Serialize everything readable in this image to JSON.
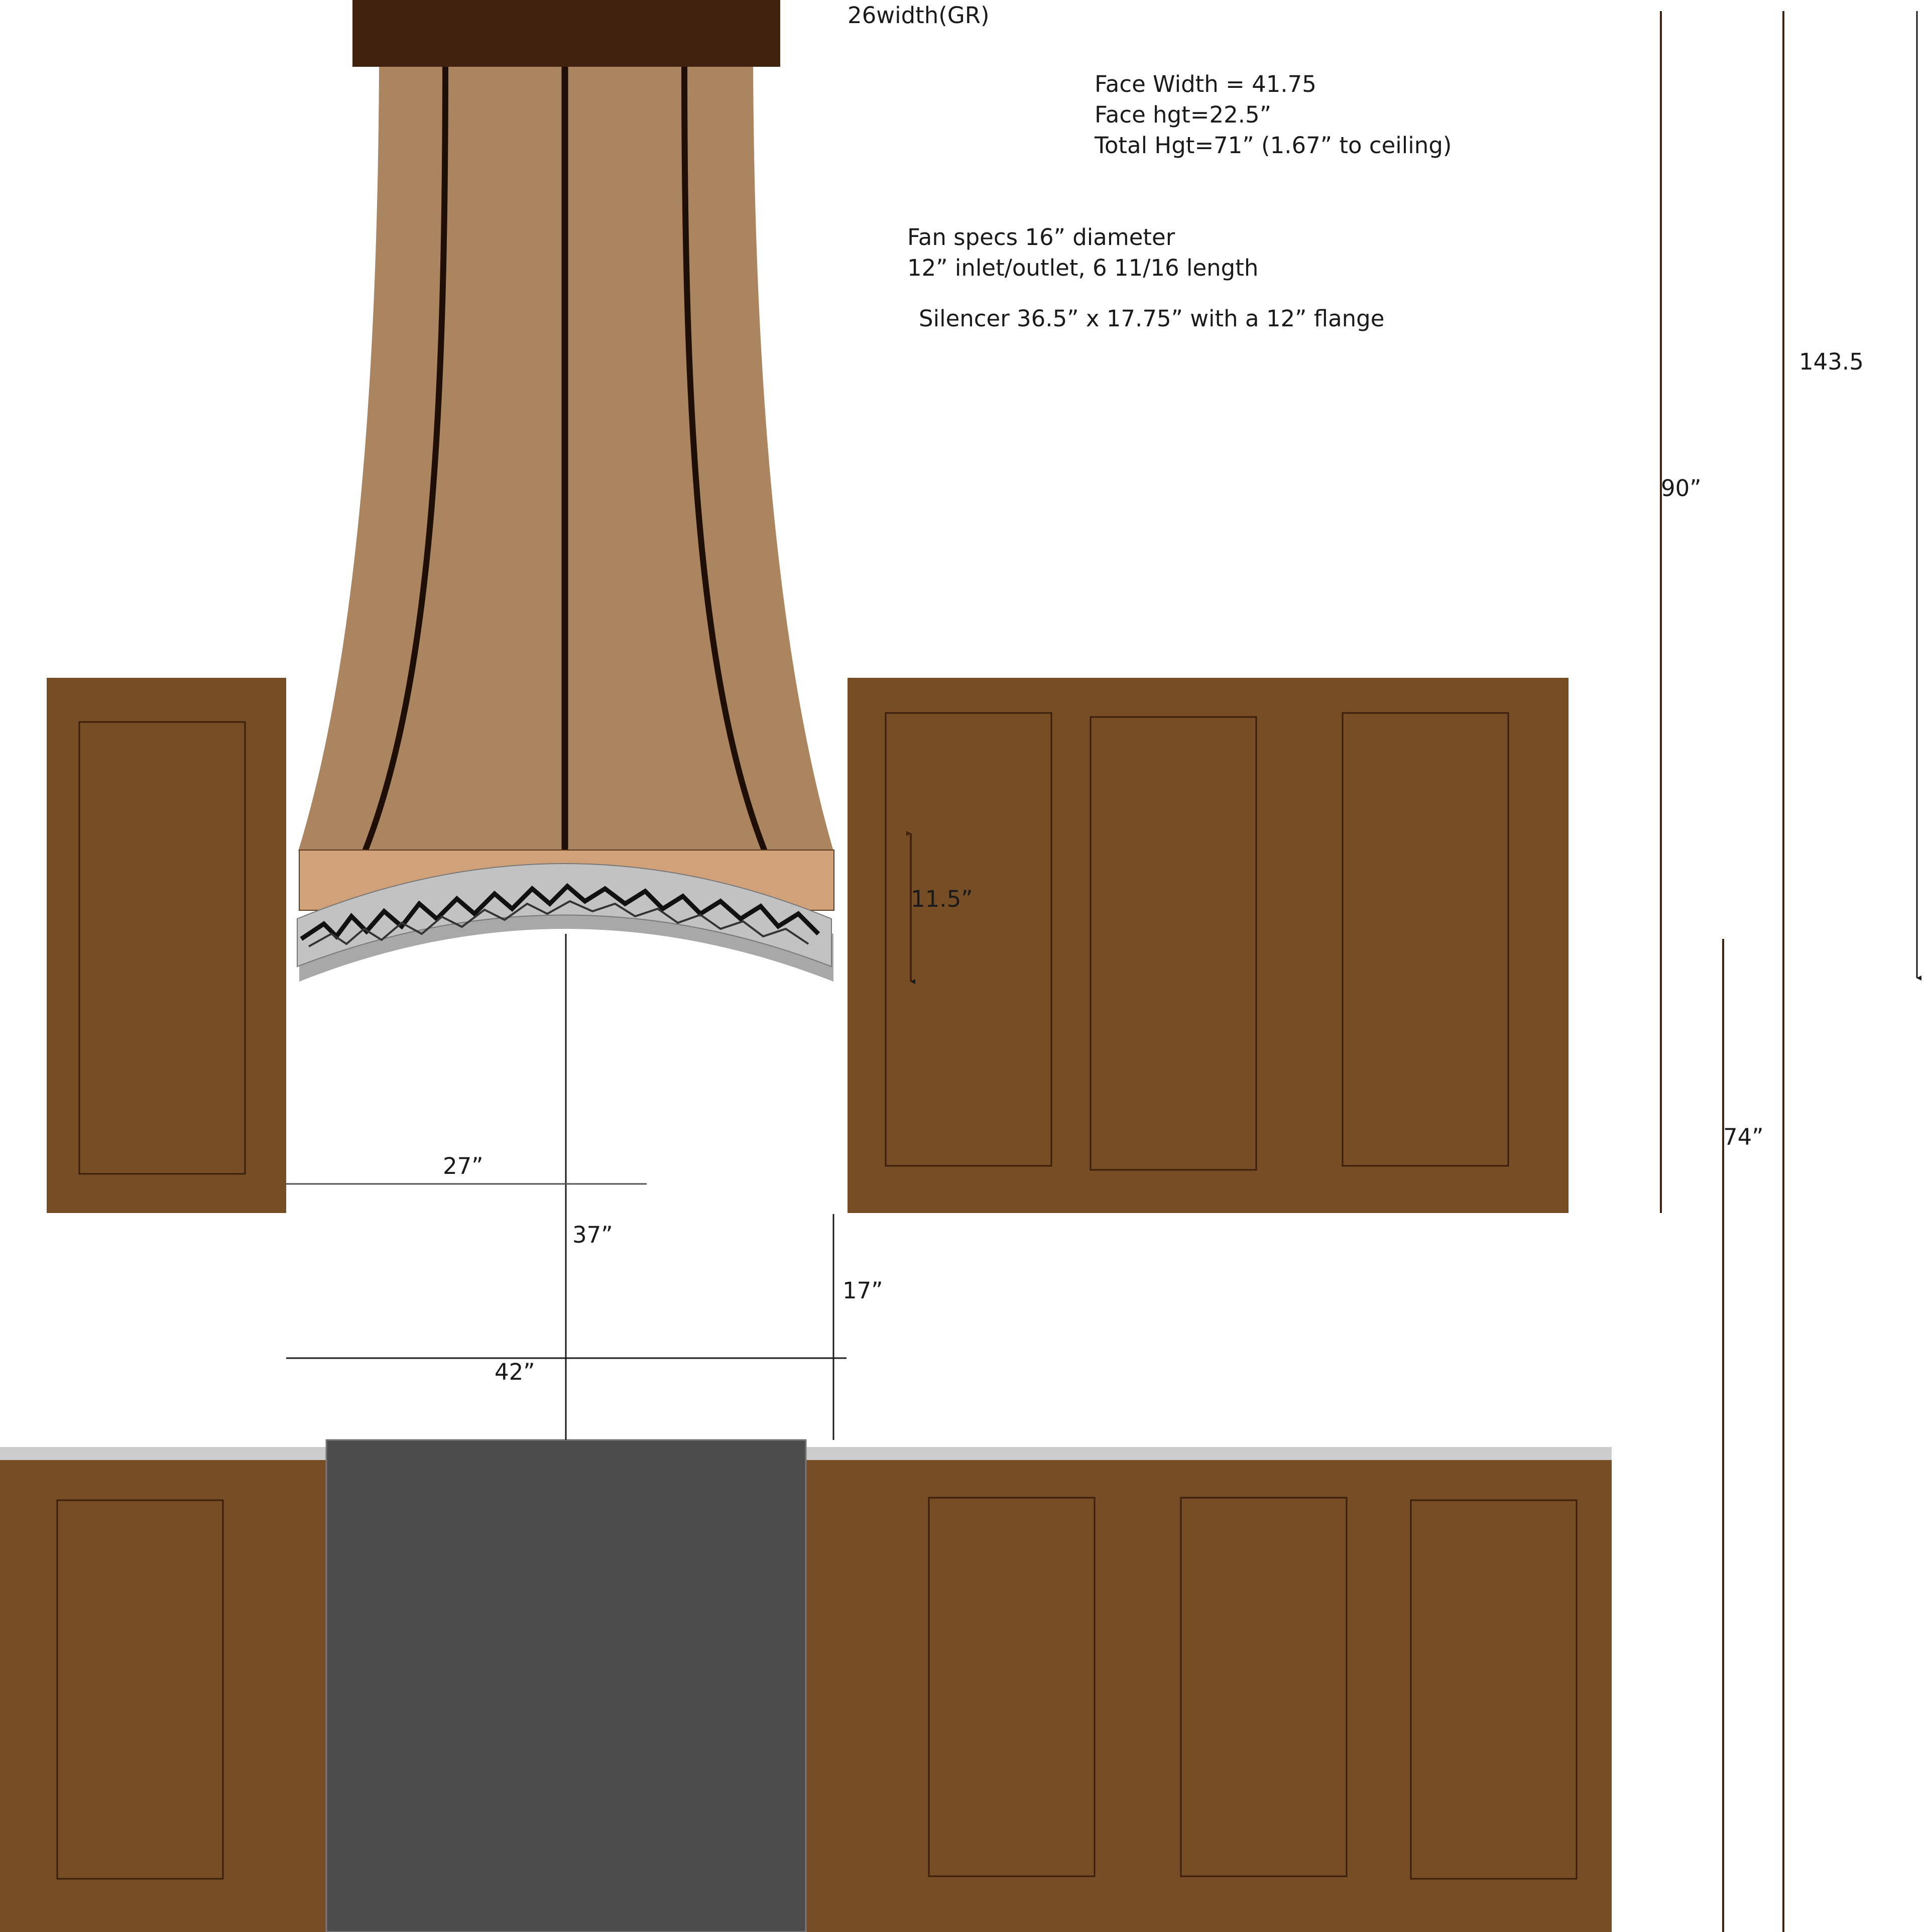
{
  "header": {
    "top_label": "26width(GR)"
  },
  "notes": {
    "face_width": "Face Width = 41.75",
    "face_height": "Face hgt=22.5”",
    "total_height": "Total Hgt=71” (1.67” to ceiling)",
    "fan_specs": "Fan specs   16” diameter",
    "fan_inlet": "12” inlet/outlet, 6 11/16 length",
    "silencer": "Silencer 36.5” x 17.75” with a 12”  flange"
  },
  "dimensions": {
    "ceiling_height": "143.5",
    "upper_to_ceiling": "90”",
    "floor_to_upper": "74”",
    "band_height": "11.5”",
    "left_clearance": "27”",
    "hood_clearance": "37”",
    "counter_to_upper": "17”",
    "cooktop_width": "42”"
  },
  "colors": {
    "cabinet": "#774D26",
    "hood_body": "#AB8460",
    "hood_band": "#D1A27A",
    "duct_cap": "#40220E",
    "strap": "#1E0E05",
    "trim": "#C2C2C2",
    "trim_shadow": "#A8A8A8",
    "range": "#4C4C4C",
    "countertop": "#CCCCCC"
  }
}
